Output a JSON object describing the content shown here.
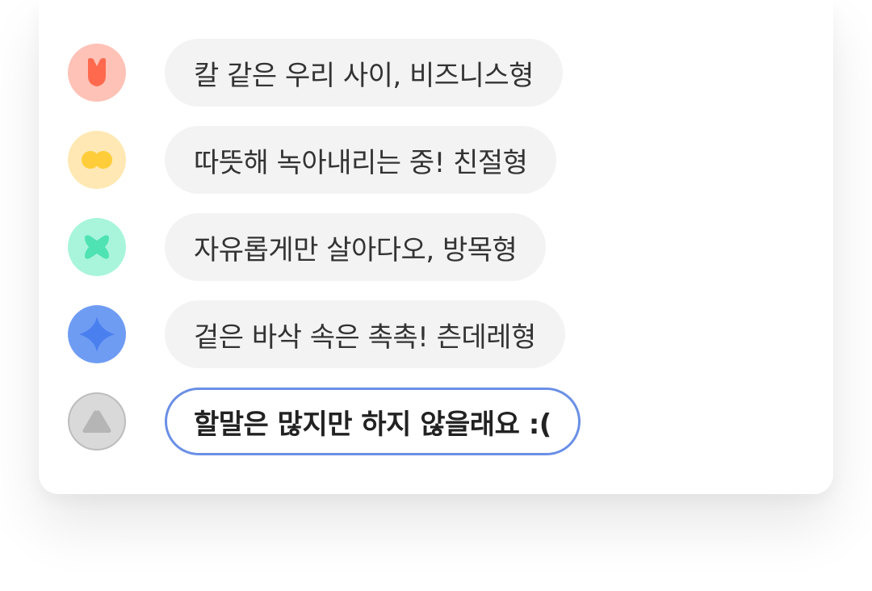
{
  "options": [
    {
      "label": "칼 같은 우리 사이, 비즈니스형",
      "icon": "shield-icon",
      "avatar_bg": "#ffc2b7",
      "icon_color": "#ff6a4e",
      "selected": false
    },
    {
      "label": "따뜻해 녹아내리는 중! 친절형",
      "icon": "double-circle-icon",
      "avatar_bg": "#ffe8b3",
      "icon_color": "#ffcd3a",
      "selected": false
    },
    {
      "label": "자유롭게만 살아다오, 방목형",
      "icon": "cross-blob-icon",
      "avatar_bg": "#a8f5dc",
      "icon_color": "#4fe2b2",
      "selected": false
    },
    {
      "label": "겉은 바삭 속은 촉촉! 츤데레형",
      "icon": "sparkle-icon",
      "avatar_bg": "#6f9cf3",
      "icon_color": "#4a7ff0",
      "selected": false
    },
    {
      "label": "할말은 많지만 하지 않을래요 :(",
      "icon": "triangle-icon",
      "avatar_bg": "#d9d9d9",
      "icon_color": "#b5b5b5",
      "selected": true,
      "selected_border": "#6a8fe6"
    }
  ]
}
